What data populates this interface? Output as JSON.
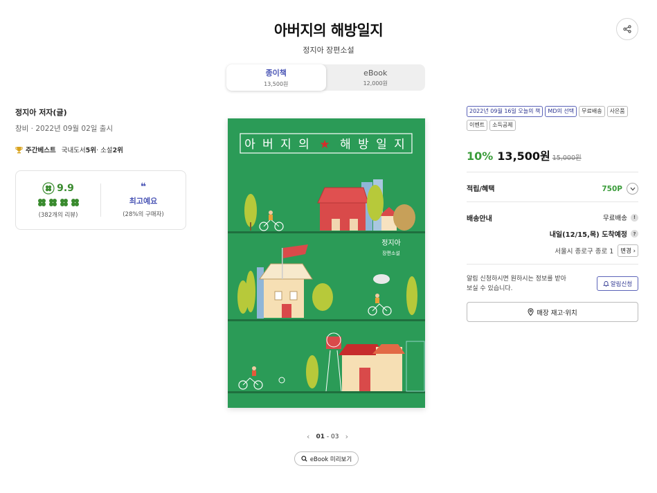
{
  "header": {
    "title": "아버지의 해방일지",
    "subtitle": "정지아 장편소설"
  },
  "format_tabs": [
    {
      "label": "종이책",
      "price": "13,500원",
      "active": true
    },
    {
      "label": "eBook",
      "price": "12,000원",
      "active": false
    }
  ],
  "left": {
    "author": "정지아 저자(글)",
    "pubinfo": "창비 · 2022년 09월 02일 출시",
    "weekly_best": {
      "label": "주간베스트",
      "domestic_prefix": "국내도서 ",
      "domestic_rank": "5위",
      "sep": " · 소설 ",
      "novel_rank": "2위"
    },
    "rating": {
      "score": "9.9",
      "reviews": "(382개의 리뷰)",
      "emotion": "최고예요",
      "emotion_pct": "(28%의 구매자)"
    }
  },
  "cover": {
    "title_chars": [
      "아",
      "버",
      "지",
      "의",
      "★",
      "해",
      "방",
      "일",
      "지"
    ],
    "author": "정지아",
    "genre": "장편소설",
    "colors": {
      "bg": "#2b9b57",
      "line": "#1f6f3e"
    }
  },
  "pager": {
    "current": "01",
    "sep": " - ",
    "total": "03"
  },
  "preview_label": "eBook 미리보기",
  "right": {
    "tags": [
      {
        "text": "2022년 09월 16일 오늘의 책",
        "highlight": true
      },
      {
        "text": "MD의 선택",
        "highlight": true
      },
      {
        "text": "무료배송",
        "highlight": false
      },
      {
        "text": "사은품",
        "highlight": false
      },
      {
        "text": "이벤트",
        "highlight": false
      },
      {
        "text": "소득공제",
        "highlight": false
      }
    ],
    "discount": "10%",
    "price": "13,500원",
    "original_price": "15,000원",
    "points_label": "적립/혜택",
    "points_value": "750P",
    "shipping_label": "배송안내",
    "shipping_free": "무료배송",
    "arrival": "내일(12/15,목) 도착예정",
    "address": "서울시 종로구 종로 1",
    "change_label": "변경",
    "notice": "알림 신청하시면 원하시는 정보를 받아 보실 수 있습니다.",
    "alert_label": "알림신청",
    "store_label": "매장 재고·위치"
  },
  "colors": {
    "accent": "#4a55b5",
    "green": "#3a9c3a"
  }
}
